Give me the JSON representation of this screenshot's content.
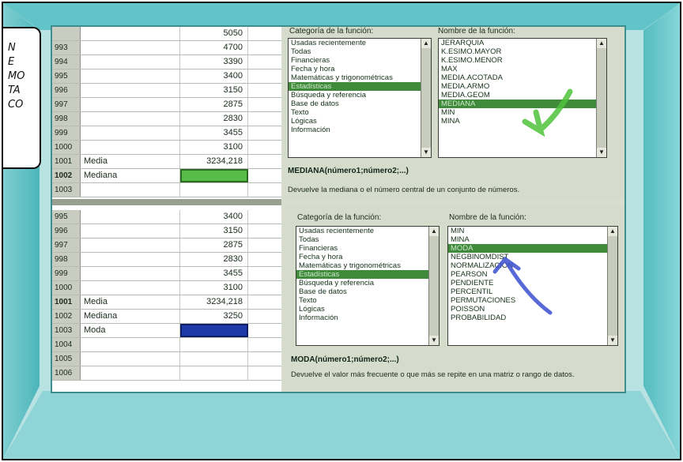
{
  "balloon": {
    "lines": [
      "N",
      "E",
      "MO",
      "TA",
      "CO"
    ]
  },
  "sheet_top": {
    "rows": [
      {
        "n": "",
        "a": "",
        "b": "5050"
      },
      {
        "n": "993",
        "a": "",
        "b": "4700"
      },
      {
        "n": "994",
        "a": "",
        "b": "3390"
      },
      {
        "n": "995",
        "a": "",
        "b": "3400"
      },
      {
        "n": "996",
        "a": "",
        "b": "3150"
      },
      {
        "n": "997",
        "a": "",
        "b": "2875"
      },
      {
        "n": "998",
        "a": "",
        "b": "2830"
      },
      {
        "n": "999",
        "a": "",
        "b": "3455"
      },
      {
        "n": "1000",
        "a": "",
        "b": "3100"
      },
      {
        "n": "1001",
        "a": "Media",
        "b": "3234,218"
      },
      {
        "n": "1002",
        "a": "Mediana",
        "b": ""
      },
      {
        "n": "1003",
        "a": "",
        "b": ""
      }
    ]
  },
  "sheet_bottom": {
    "rows": [
      {
        "n": "995",
        "a": "",
        "b": "3400"
      },
      {
        "n": "996",
        "a": "",
        "b": "3150"
      },
      {
        "n": "997",
        "a": "",
        "b": "2875"
      },
      {
        "n": "998",
        "a": "",
        "b": "2830"
      },
      {
        "n": "999",
        "a": "",
        "b": "3455"
      },
      {
        "n": "1000",
        "a": "",
        "b": "3100"
      },
      {
        "n": "1001",
        "a": "Media",
        "b": "3234,218"
      },
      {
        "n": "1002",
        "a": "Mediana",
        "b": "3250"
      },
      {
        "n": "1003",
        "a": "Moda",
        "b": ""
      },
      {
        "n": "1004",
        "a": "",
        "b": ""
      },
      {
        "n": "1005",
        "a": "",
        "b": ""
      },
      {
        "n": "1006",
        "a": "",
        "b": ""
      }
    ]
  },
  "dialog_top": {
    "category_label": "Categoría de la función:",
    "name_label": "Nombre de la función:",
    "categories": [
      "Usadas recientemente",
      "Todas",
      "Financieras",
      "Fecha y hora",
      "Matemáticas y trigonométricas",
      "Estadísticas",
      "Búsqueda y referencia",
      "Base de datos",
      "Texto",
      "Lógicas",
      "Información"
    ],
    "functions": [
      "JERARQUIA",
      "K.ESIMO.MAYOR",
      "K.ESIMO.MENOR",
      "MAX",
      "MEDIA.ACOTADA",
      "MEDIA.ARMO",
      "MEDIA.GEOM",
      "MEDIANA",
      "MIN",
      "MINA"
    ],
    "syntax": "MEDIANA(número1;número2;...)",
    "description": "Devuelve la mediana o el número central de un conjunto de números."
  },
  "dialog_bottom": {
    "category_label": "Categoría de la función:",
    "name_label": "Nombre de la función:",
    "categories": [
      "Usadas recientemente",
      "Todas",
      "Financieras",
      "Fecha y hora",
      "Matemáticas y trigonométricas",
      "Estadísticas",
      "Búsqueda y referencia",
      "Base de datos",
      "Texto",
      "Lógicas",
      "Información"
    ],
    "functions": [
      "MIN",
      "MINA",
      "MODA",
      "NEGBINOMDIST",
      "NORMALIZACION",
      "PEARSON",
      "PENDIENTE",
      "PERCENTIL",
      "PERMUTACIONES",
      "POISSON",
      "PROBABILIDAD"
    ],
    "syntax": "MODA(número1;número2;...)",
    "description": "Devuelve el valor más frecuente o que más se repite en una matriz o rango de datos."
  },
  "colors": {
    "frame": "#62c4c8",
    "selection_green": "#58bc48",
    "selection_blue": "#1e3aa8",
    "list_selected": "#3f8a3b"
  }
}
